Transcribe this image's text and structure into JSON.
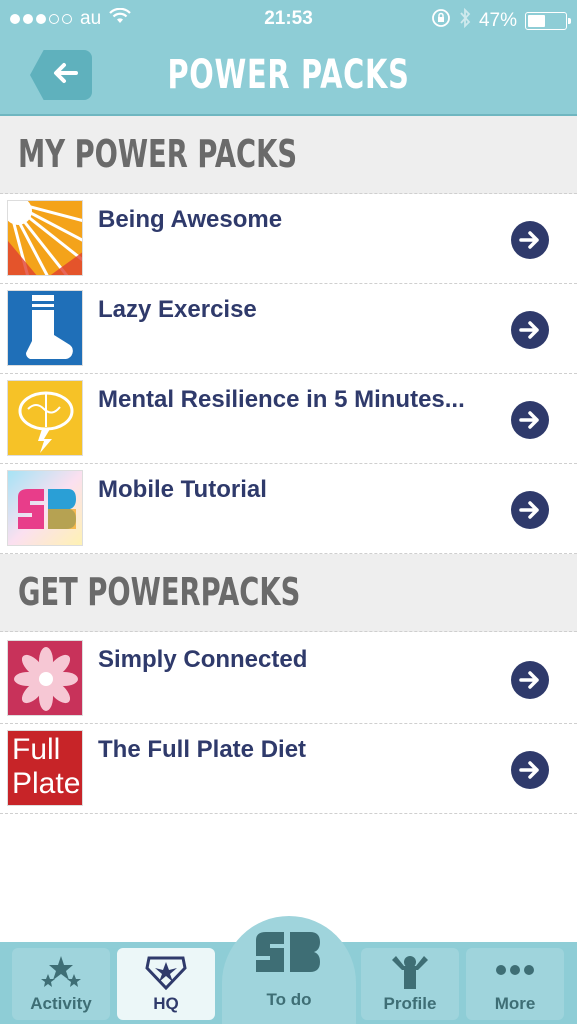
{
  "status": {
    "carrier": "au",
    "time": "21:53",
    "battery": "47%",
    "battery_level": 0.47
  },
  "header": {
    "title": "POWER PACKS",
    "back_icon": "arrow-left-icon"
  },
  "sections": {
    "my": {
      "title": "MY POWER PACKS",
      "items": [
        {
          "label": "Being Awesome",
          "icon": "sunburst-icon"
        },
        {
          "label": "Lazy Exercise",
          "icon": "sock-icon"
        },
        {
          "label": "Mental Resilience in 5 Minutes...",
          "icon": "brain-lightning-icon"
        },
        {
          "label": "Mobile Tutorial",
          "icon": "sb-logo-icon"
        }
      ]
    },
    "get": {
      "title": "GET POWERPACKS",
      "items": [
        {
          "label": "Simply Connected",
          "icon": "flower-icon"
        },
        {
          "label": "The Full Plate Diet",
          "icon": "full-plate-logo",
          "logo_line1": "Full",
          "logo_line2": "Plate"
        }
      ]
    }
  },
  "tabs": {
    "activity": "Activity",
    "hq": "HQ",
    "todo": "To do",
    "profile": "Profile",
    "more": "More"
  },
  "colors": {
    "header_bg": "#8ecdd6",
    "accent_navy": "#2f3a6b",
    "section_bg": "#eeeeee"
  }
}
